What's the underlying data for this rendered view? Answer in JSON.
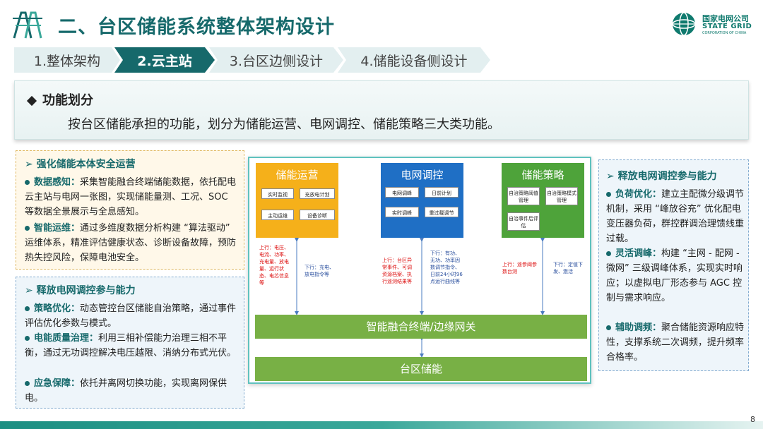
{
  "header": {
    "title": "二、台区储能系统整体架构设计",
    "logo_cn": "国家电网公司",
    "logo_en": "STATE GRID",
    "logo_sub": "CORPORATION OF CHINA",
    "left_logo_icon": "power-tower-icon",
    "right_logo_icon": "state-grid-globe-icon"
  },
  "tabs": [
    {
      "label": "1.整体架构",
      "active": false
    },
    {
      "label": "2.云主站",
      "active": true
    },
    {
      "label": "3.台区边侧设计",
      "active": false
    },
    {
      "label": "4.储能设备侧设计",
      "active": false
    }
  ],
  "banner": {
    "heading": "功能划分",
    "text": "按台区储能承担的功能，划分为储能运营、电网调控、储能策略三大类功能。"
  },
  "left_top": {
    "title": "强化储能本体安全运营",
    "items": [
      {
        "label": "数据感知：",
        "text": "采集智能融合终端储能数据，依托配电云主站与电网一张图，实现储能量测、工况、SOC 等数据全景展示与全息感知。"
      },
      {
        "label": "智能运维：",
        "text": "通过多维度数据分析构建 “算法驱动” 运维体系，精准评估健康状态、诊断设备故障，预防热失控风险，保障电池安全。"
      }
    ]
  },
  "left_bottom": {
    "title": "释放电网调控参与能力",
    "items": [
      {
        "label": "策略优化：",
        "text": "动态管控台区储能自治策略，通过事件评估优化参数与模式。"
      },
      {
        "label": "电能质量治理：",
        "text": "利用三相补偿能力治理三相不平衡，通过无功调控解决电压越限、消纳分布式光伏。"
      },
      {
        "label": "应急保障：",
        "text": "依托并离网切换功能，实现离网保供电。"
      }
    ]
  },
  "right": {
    "title": "释放电网调控参与能力",
    "items": [
      {
        "label": "负荷优化：",
        "text": "建立主配微分级调节机制，采用 “峰放谷充” 优化配电变压器负荷，群控群调治理馈线重过载。"
      },
      {
        "label": "灵活调峰：",
        "text": "构建 “主网 - 配网 - 微网” 三级调峰体系，实现实时响应；以虚拟电厂形态参与 AGC 控制与需求响应。"
      },
      {
        "label": "辅助调频：",
        "text": "聚合储能资源响应特性，支撑系统二次调频，提升频率合格率。"
      }
    ]
  },
  "diagram": {
    "blocks": [
      {
        "title": "储能运营",
        "color": "#f5b01a",
        "chips": [
          "实时监视",
          "充放电计划",
          "主动运维",
          "设备诊断"
        ]
      },
      {
        "title": "电网调控",
        "color": "#1f6fc5",
        "chips": [
          "电网调峰",
          "日前计划",
          "实时调峰",
          "重过载调节"
        ]
      },
      {
        "title": "储能策略",
        "color": "#4ea33a",
        "chips": [
          "自治策略阈值管理",
          "自治策略模式管理",
          "自治事件后评估"
        ]
      }
    ],
    "notes": {
      "up1": "上行：电压、电流、功率、充电量、放电量、运行状态、电芯信息等",
      "down1": "下行：充电、放电指令等",
      "up2": "上行：台区异常事件、可调资源档案、执行遥测结果等",
      "down2": "下行：有功、无功、功率因数调节指令、日前24小时96点运行曲线等",
      "up3": "上行：遥参阈参数台测",
      "down3": "下行：定值下发、激活"
    },
    "gateway": "智能融合终端/边缘网关",
    "storage": "台区储能"
  },
  "footer": {
    "page": "8"
  },
  "colors": {
    "accent": "#16696b",
    "tab_active": "#16696b",
    "bar_green": "#78b045"
  }
}
